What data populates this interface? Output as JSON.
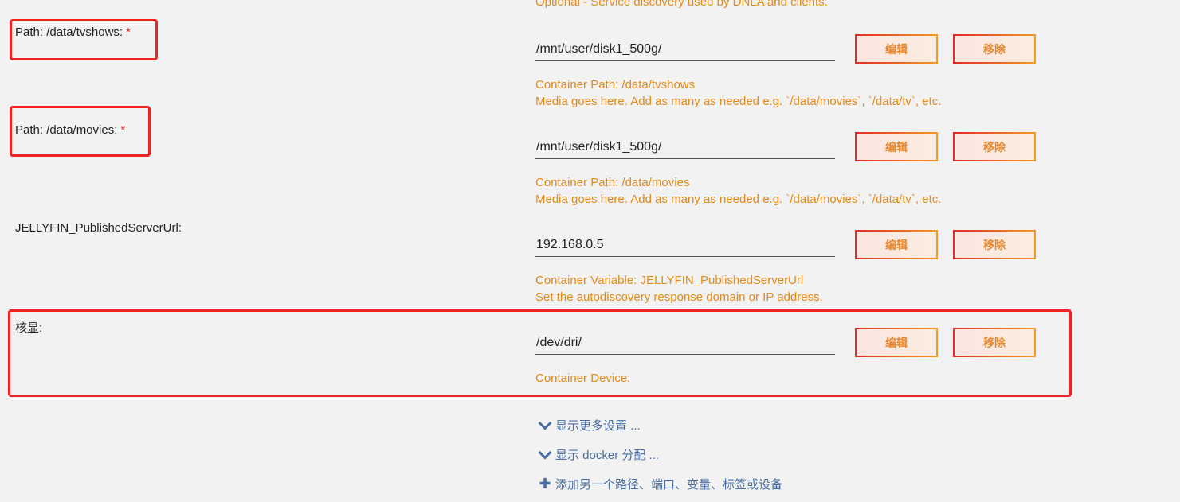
{
  "top_note": "Optional - Service discovery used by DNLA and clients.",
  "entries": [
    {
      "label": "Path: /data/tvshows:",
      "required_mark": "*",
      "value": "/mnt/user/disk1_500g/",
      "edit_label": "编辑",
      "remove_label": "移除",
      "help_line1": "Container Path: /data/tvshows",
      "help_line2": "Media goes here. Add as many as needed e.g. `/data/movies`, `/data/tv`, etc."
    },
    {
      "label": "Path: /data/movies:",
      "required_mark": "*",
      "value": "/mnt/user/disk1_500g/",
      "edit_label": "编辑",
      "remove_label": "移除",
      "help_line1": "Container Path: /data/movies",
      "help_line2": "Media goes here. Add as many as needed e.g. `/data/movies`, `/data/tv`, etc."
    },
    {
      "label": "JELLYFIN_PublishedServerUrl:",
      "value": "192.168.0.5",
      "edit_label": "编辑",
      "remove_label": "移除",
      "help_line1": "Container Variable: JELLYFIN_PublishedServerUrl",
      "help_line2": "Set the autodiscovery response domain or IP address."
    },
    {
      "label": "核显:",
      "value": "/dev/dri/",
      "edit_label": "编辑",
      "remove_label": "移除",
      "help_line1": "Container Device:"
    }
  ],
  "links": {
    "show_more": "显示更多设置 ...",
    "show_docker": "显示 docker 分配 ...",
    "add_another": "添加另一个路径、端口、变量、标签或设备"
  },
  "colors": {
    "accent_orange": "#e58a17",
    "highlight_red": "#f02222",
    "link_blue": "#486ea5"
  }
}
